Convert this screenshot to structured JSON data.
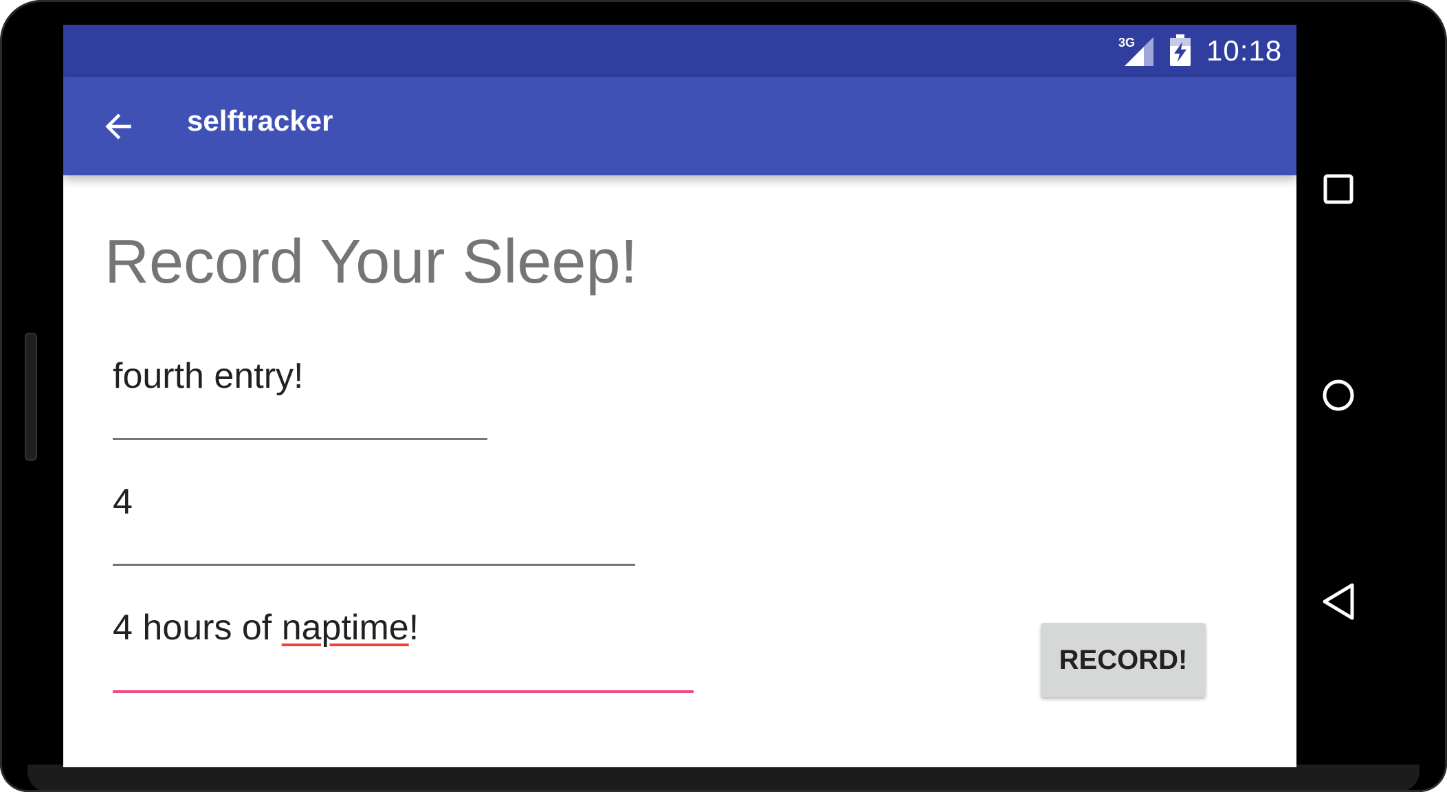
{
  "status_bar": {
    "network": "3G",
    "time": "10:18",
    "icons": [
      "signal-icon",
      "battery-charging-icon"
    ]
  },
  "app_bar": {
    "title": "selftracker",
    "back_icon": "arrow-back-icon"
  },
  "main": {
    "heading": "Record Your Sleep!",
    "entry_name": "fourth entry!",
    "hours": "4",
    "notes_prefix": "4 hours of ",
    "notes_misspelled": "naptime",
    "notes_suffix": "!",
    "record_button": "RECORD!"
  },
  "nav_bar": {
    "recents_icon": "square-recents-icon",
    "home_icon": "circle-home-icon",
    "back_icon": "triangle-back-icon"
  },
  "colors": {
    "status_bar": "#303f9f",
    "app_bar": "#3f51b5",
    "accent": "#e91e63",
    "spell_underline": "#f44336"
  }
}
